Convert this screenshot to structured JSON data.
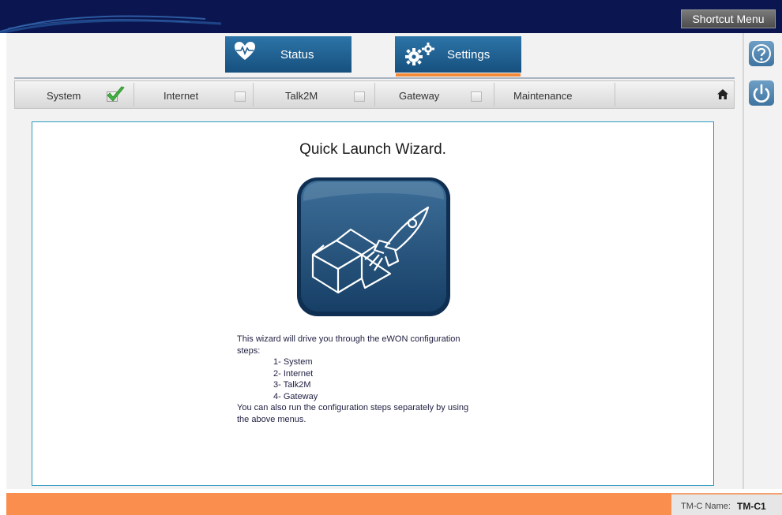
{
  "header": {
    "shortcut_menu_label": "Shortcut Menu"
  },
  "main_tabs": [
    {
      "label": "Status",
      "icon": "heart-pulse-icon"
    },
    {
      "label": "Settings",
      "icon": "gears-icon",
      "active": true
    }
  ],
  "steps": [
    {
      "label": "System",
      "completed": true
    },
    {
      "label": "Internet",
      "completed": false
    },
    {
      "label": "Talk2M",
      "completed": false
    },
    {
      "label": "Gateway",
      "completed": false
    },
    {
      "label": "Maintenance"
    }
  ],
  "wizard": {
    "title": "Quick Launch Wizard.",
    "intro_line1": "This wizard will drive you through the eWON configuration",
    "intro_line2": "steps:",
    "step_list": [
      "1- System",
      "2- Internet",
      "3- Talk2M",
      "4- Gateway"
    ],
    "outro_line1": "You can also run the configuration steps separately by using",
    "outro_line2": "the above menus."
  },
  "side_buttons": {
    "help_icon": "help-icon",
    "power_icon": "power-icon"
  },
  "footer": {
    "name_label": "TM-C Name:",
    "name_value": "TM-C1"
  },
  "colors": {
    "header_bg": "#0b1650",
    "tab_blue": "#1f5f90",
    "accent_orange": "#f28a3a",
    "footer_orange": "#f98e4f",
    "panel_border": "#2b9bbf"
  }
}
